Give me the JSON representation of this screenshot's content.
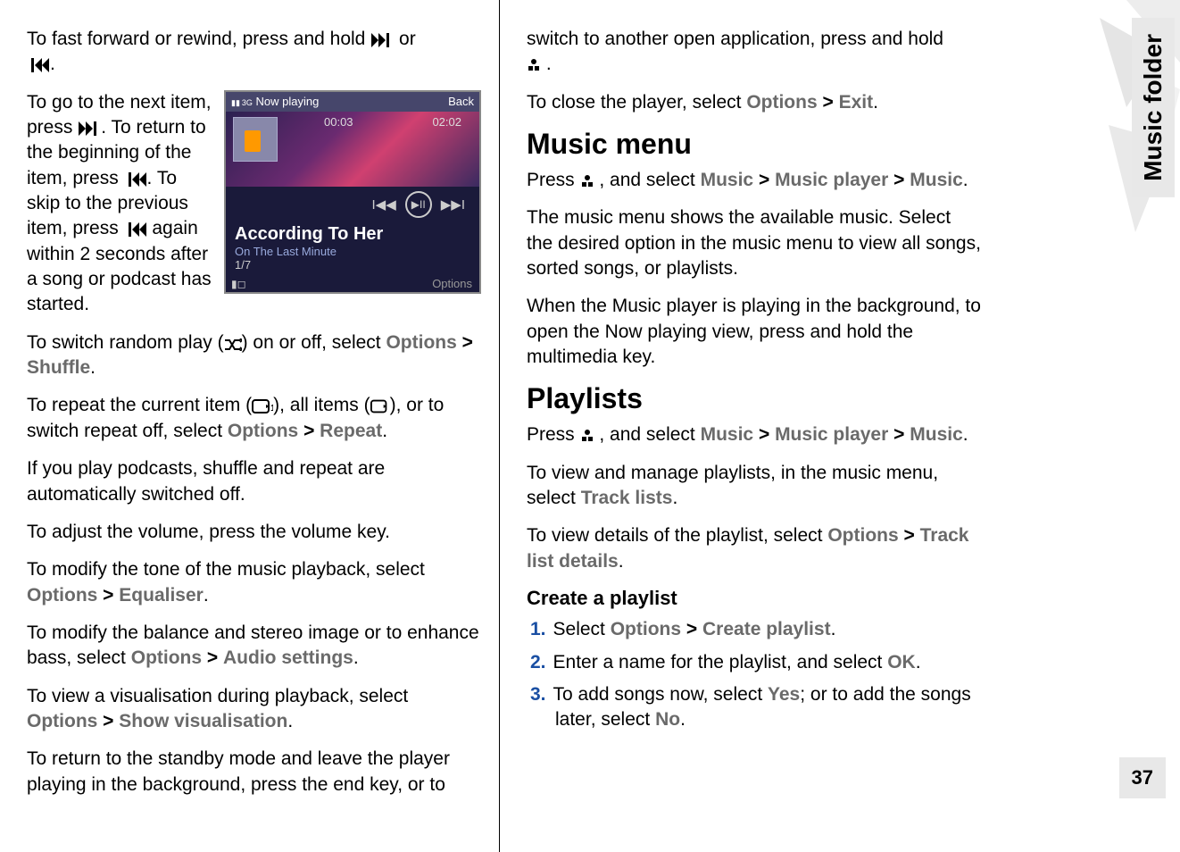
{
  "sidebar": {
    "tab": "Music folder",
    "page_number": "37"
  },
  "screenshot": {
    "top_left_signal": "3G",
    "title": "Now playing",
    "back": "Back",
    "elapsed": "00:03",
    "total": "02:02",
    "song": "According To Her",
    "album": "On The Last Minute",
    "track": "1/7",
    "options": "Options"
  },
  "left": {
    "p1_a": "To fast forward or rewind, press and hold ",
    "p1_b": " or ",
    "p1_c": ".",
    "p2_a": "To go to the next item, press ",
    "p2_b": ". To return to the beginning of the item, press ",
    "p2_c": ". To skip to the previous item, press ",
    "p2_d": " again within 2 seconds after a song or podcast has started.",
    "p3_a": "To switch random play (",
    "p3_b": ") on or off, select ",
    "p3_opt1": "Options",
    "p3_gt": ">",
    "p3_opt2": "Shuffle",
    "p3_c": ".",
    "p4_a": "To repeat the current item (",
    "p4_b": "), all items (",
    "p4_c": "), or to switch repeat off, select ",
    "p4_opt1": "Options",
    "p4_opt2": "Repeat",
    "p4_d": ".",
    "p5": "If you play podcasts, shuffle and repeat are automatically switched off.",
    "p6": "To adjust the volume, press the volume key.",
    "p7_a": "To modify the tone of the music playback, select ",
    "p7_opt1": "Options",
    "p7_opt2": "Equaliser",
    "p7_b": ".",
    "p8_a": "To modify the balance and stereo image or to enhance bass, select ",
    "p8_opt1": "Options",
    "p8_opt2": "Audio settings",
    "p8_b": ".",
    "p9_a": "To view a visualisation during playback, select ",
    "p9_opt1": "Options",
    "p9_opt2": "Show visualisation",
    "p9_b": ".",
    "p10": "To return to the standby mode and leave the player playing in the background, press the end key, or to"
  },
  "right": {
    "p1_a": "switch to another open application, press and hold ",
    "p1_b": " .",
    "p2_a": "To close the player, select ",
    "p2_opt1": "Options",
    "p2_opt2": "Exit",
    "p2_b": ".",
    "h_music_menu": "Music menu",
    "p3_a": "Press ",
    "p3_b": " , and select ",
    "p3_m1": "Music",
    "p3_m2": "Music player",
    "p3_m3": "Music",
    "p3_c": ".",
    "p4": "The music menu shows the available music. Select the desired option in the music menu to view all songs, sorted songs, or playlists.",
    "p5": "When the Music player is playing in the background, to open the Now playing view, press and hold the multimedia key.",
    "h_playlists": "Playlists",
    "p6_a": "Press ",
    "p6_b": " , and select ",
    "p6_m1": "Music",
    "p6_m2": "Music player",
    "p6_m3": "Music",
    "p6_c": ".",
    "p7_a": "To view and manage playlists, in the music menu, select ",
    "p7_m1": "Track lists",
    "p7_b": ".",
    "p8_a": "To view details of the playlist, select ",
    "p8_m1": "Options",
    "p8_m2": "Track list details",
    "p8_b": ".",
    "h_create": "Create a playlist",
    "li1_a": "Select ",
    "li1_m1": "Options",
    "li1_m2": "Create playlist",
    "li1_b": ".",
    "li2_a": "Enter a name for the playlist, and select ",
    "li2_m1": "OK",
    "li2_b": ".",
    "li3_a": "To add songs now, select ",
    "li3_m1": "Yes",
    "li3_b": "; or to add the songs later, select ",
    "li3_m2": "No",
    "li3_c": ".",
    "n1": "1.",
    "n2": "2.",
    "n3": "3."
  }
}
